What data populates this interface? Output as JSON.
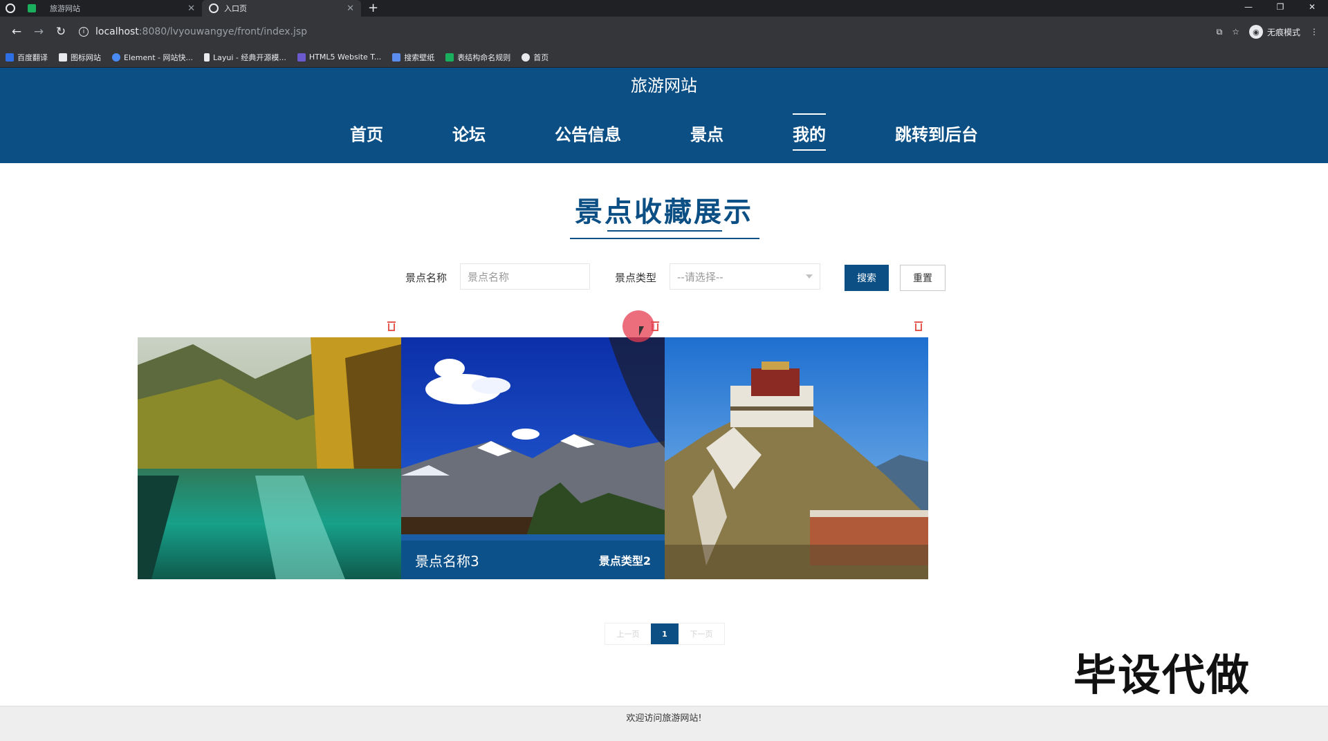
{
  "browser": {
    "tabs": [
      {
        "label": "旅游网站",
        "active": false
      },
      {
        "label": "入口页",
        "active": true
      }
    ],
    "url_host": "localhost",
    "url_path": ":8080/lvyouwangye/front/index.jsp",
    "profile_label": "无痕模式",
    "bookmarks": [
      {
        "label": "百度翻译",
        "color": "#2f6fe4"
      },
      {
        "label": "图标网站",
        "color": "#e8eaed"
      },
      {
        "label": "Element - 网站快...",
        "color": "#4a8af4"
      },
      {
        "label": "Layui - 经典开源模...",
        "color": "#e8eaed"
      },
      {
        "label": "HTML5 Website T...",
        "color": "#6a5acd"
      },
      {
        "label": "搜索壁纸",
        "color": "#5b8def"
      },
      {
        "label": "表结构命名规则",
        "color": "#1aaf5d"
      },
      {
        "label": "首页",
        "color": "#e8eaed"
      }
    ]
  },
  "site": {
    "title": "旅游网站",
    "nav": [
      "首页",
      "论坛",
      "公告信息",
      "景点",
      "我的",
      "跳转到后台"
    ],
    "active_nav": "我的"
  },
  "main": {
    "section_title": "景点收藏展示",
    "filters": {
      "name_label": "景点名称",
      "name_placeholder": "景点名称",
      "type_label": "景点类型",
      "type_selected": "--请选择--",
      "search_label": "搜索",
      "reset_label": "重置"
    },
    "cards": [
      {
        "image": "jiuzhaigou-lake",
        "name": "",
        "type": ""
      },
      {
        "image": "snow-mountain-lake",
        "name": "景点名称3",
        "type": "景点类型2"
      },
      {
        "image": "potala-palace",
        "name": "",
        "type": ""
      }
    ],
    "pager": {
      "prev": "上一页",
      "current": "1",
      "next": "下一页"
    }
  },
  "watermark": "毕设代做",
  "footer": "欢迎访问旅游网站!",
  "colors": {
    "brand": "#0b4f84",
    "danger": "#e5584f"
  }
}
